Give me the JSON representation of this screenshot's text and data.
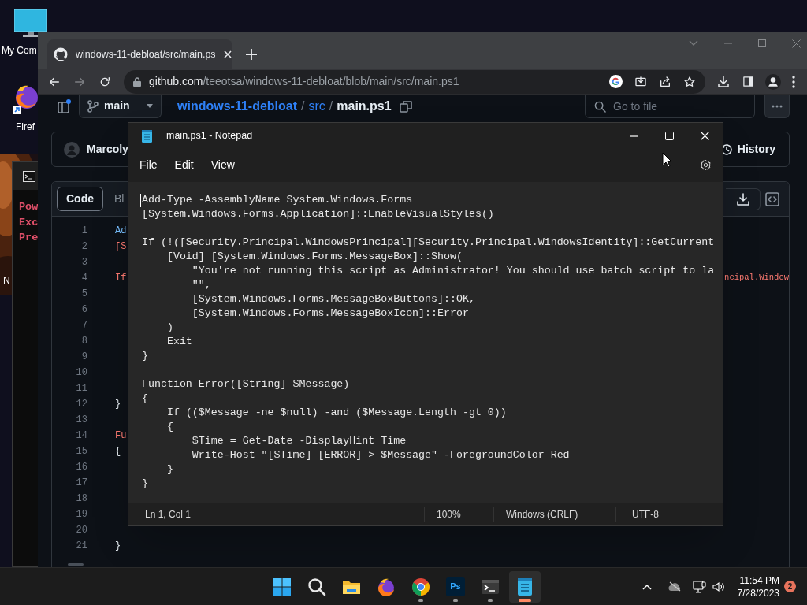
{
  "desktop": {
    "icons": [
      {
        "kind": "computer",
        "label": "My Com"
      },
      {
        "kind": "firefox",
        "label": "Firef"
      },
      {
        "kind": "hidden",
        "label": "N"
      }
    ]
  },
  "terminal_window": {
    "lines": [
      "Pow",
      "Exc",
      "Pre"
    ]
  },
  "browser": {
    "tabs": [
      {
        "title": "windows-11-debloat/src/main.ps",
        "selected": true
      }
    ],
    "address": {
      "host": "github.com",
      "path": "/teeotsa/windows-11-debloat/blob/main/src/main.ps1"
    },
    "repo_header": {
      "branch": "main",
      "breadcrumb": [
        {
          "label": "windows-11-debloat",
          "kind": "repo"
        },
        {
          "label": "/",
          "kind": "separator"
        },
        {
          "label": "src",
          "kind": "folder"
        },
        {
          "label": "/",
          "kind": "separator"
        },
        {
          "label": "main.ps1",
          "kind": "file"
        }
      ],
      "search_placeholder": "Go to file"
    },
    "commit": {
      "author": "Marcoly",
      "history_label": "History"
    },
    "viewer_tabs": [
      {
        "label": "Code",
        "selected": true
      },
      {
        "label": "Bl",
        "selected": false
      }
    ],
    "code_lines": [
      {
        "number": "1",
        "text": "Ad",
        "kind": "command"
      },
      {
        "number": "2",
        "text": "[S",
        "kind": "keyword"
      },
      {
        "number": "3"
      },
      {
        "number": "4",
        "text": "If",
        "kind": "keyword",
        "tail": "ncipal.Window"
      },
      {
        "number": "5"
      },
      {
        "number": "6"
      },
      {
        "number": "7"
      },
      {
        "number": "8"
      },
      {
        "number": "9"
      },
      {
        "number": "10"
      },
      {
        "number": "11"
      },
      {
        "number": "12",
        "text": "}",
        "kind": "plain"
      },
      {
        "number": "13"
      },
      {
        "number": "14",
        "text": "Fu",
        "kind": "keyword"
      },
      {
        "number": "15",
        "text": "{",
        "kind": "plain"
      },
      {
        "number": "16"
      },
      {
        "number": "17"
      },
      {
        "number": "18"
      },
      {
        "number": "19"
      },
      {
        "number": "20"
      },
      {
        "number": "21",
        "text": "}",
        "kind": "plain"
      }
    ]
  },
  "notepad": {
    "title": "main.ps1 - Notepad",
    "menu": [
      "File",
      "Edit",
      "View"
    ],
    "text_blocks": [
      [
        "Add-Type -AssemblyName System.Windows.Forms",
        "[System.Windows.Forms.Application]::EnableVisualStyles()"
      ],
      [
        "If (!([Security.Principal.WindowsPrincipal][Security.Principal.WindowsIdentity]::GetCurrent",
        "    [Void] [System.Windows.Forms.MessageBox]::Show(",
        "        \"You're not running this script as Administrator! You should use batch script to la",
        "        \"\",",
        "        [System.Windows.Forms.MessageBoxButtons]::OK,",
        "        [System.Windows.Forms.MessageBoxIcon]::Error",
        "    )",
        "    Exit",
        "}"
      ],
      [
        "Function Error([String] $Message)",
        "{",
        "    If (($Message -ne $null) -and ($Message.Length -gt 0))",
        "    {",
        "        $Time = Get-Date -DisplayHint Time",
        "        Write-Host \"[$Time] [ERROR] > $Message\" -ForegroundColor Red",
        "    }",
        "}"
      ]
    ],
    "status": [
      "Ln 1, Col 1",
      "100%",
      "Windows (CRLF)",
      "UTF-8"
    ]
  },
  "taskbar": {
    "apps": [
      {
        "kind": "start",
        "running": false,
        "active": false
      },
      {
        "kind": "search",
        "running": false,
        "active": false
      },
      {
        "kind": "files",
        "running": false,
        "active": false
      },
      {
        "kind": "firefox",
        "running": false,
        "active": false
      },
      {
        "kind": "chrome",
        "running": true,
        "active": false
      },
      {
        "kind": "photoshop",
        "label": "Ps",
        "running": true,
        "active": false
      },
      {
        "kind": "terminal",
        "running": true,
        "active": false
      },
      {
        "kind": "notepad",
        "running": true,
        "active": true
      }
    ],
    "time": "11:54 PM",
    "date": "7/28/2023",
    "notification_count": "2"
  }
}
